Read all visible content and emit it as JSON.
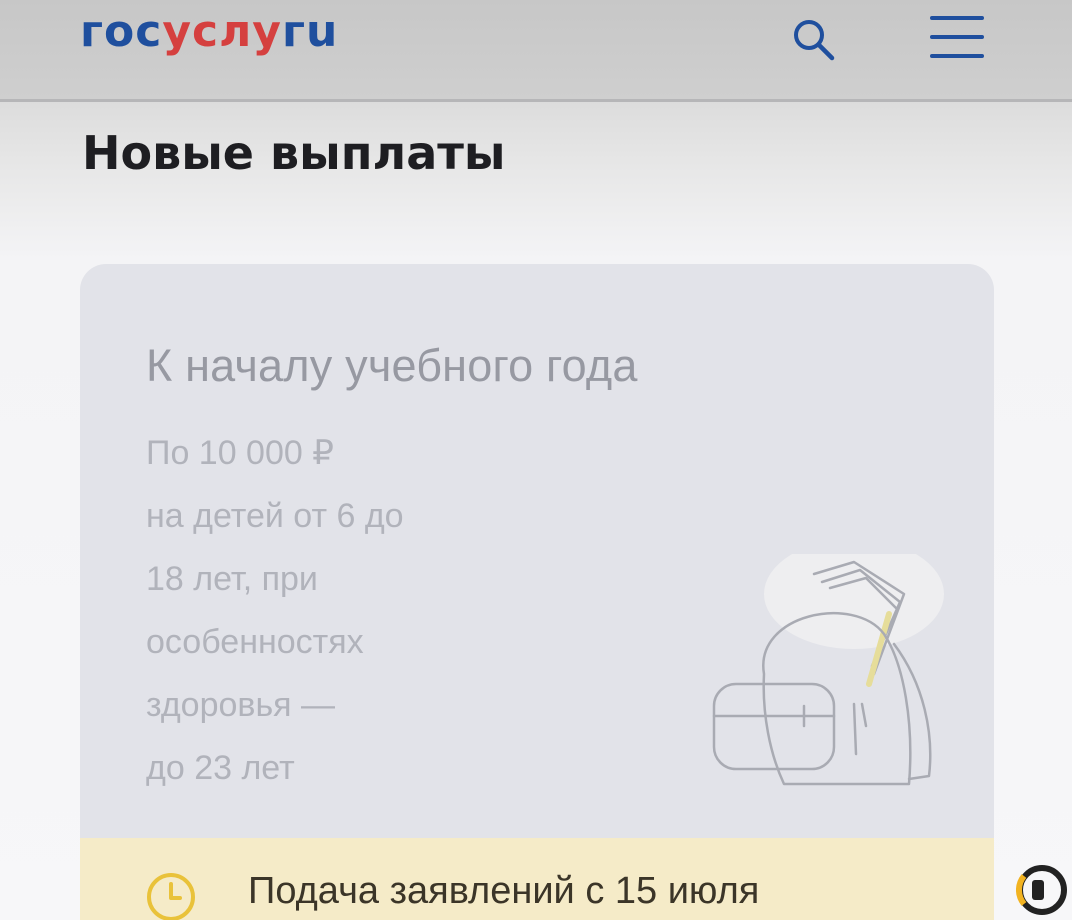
{
  "header": {
    "logo_part1": "гос",
    "logo_part2": "услу",
    "logo_part3": "гu",
    "search_icon": "search-icon",
    "menu_icon": "hamburger-menu-icon"
  },
  "page": {
    "title": "Новые выплаты"
  },
  "card": {
    "title": "К началу учебного года",
    "description_lines": [
      "По 10 000 ₽",
      "на детей от 6 до",
      "18 лет, при",
      "особенностях",
      "здоровья —",
      "до 23 лет"
    ],
    "illustration": "backpack-icon",
    "footer_icon": "clock-icon",
    "footer_text": "Подача заявлений с 15 июля"
  },
  "overlay": {
    "badge_icon": "channel-logo-icon"
  },
  "colors": {
    "brand_blue": "#1f4f9e",
    "brand_red": "#d5403f",
    "card_bg": "#e2e3e9",
    "notice_bg": "#f5ebc8",
    "clock_accent": "#e9c23a"
  }
}
